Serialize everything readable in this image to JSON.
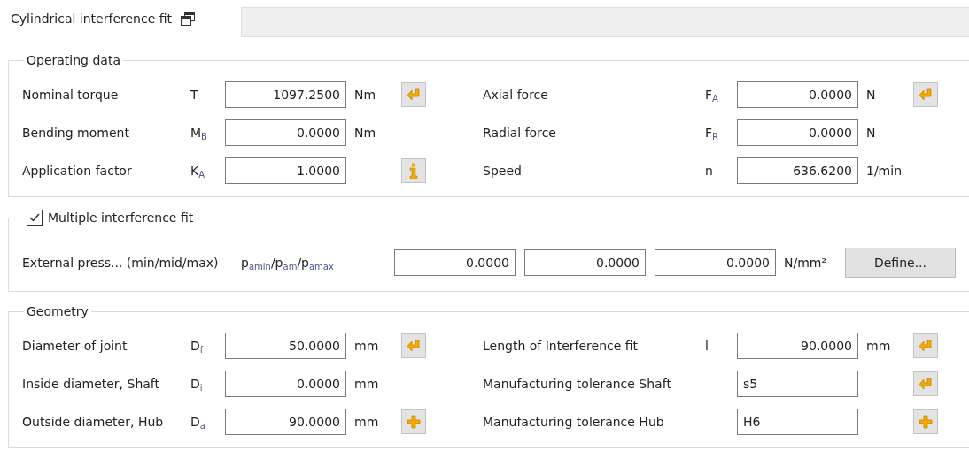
{
  "tab": {
    "title": "Cylindrical interference fit",
    "selected": true
  },
  "operating_data": {
    "title": "Operating data",
    "left": [
      {
        "kind": "numeric",
        "label": "Nominal torque",
        "symbol": "T",
        "value": "1097.2500",
        "unit": "Nm",
        "button": {
          "kind": "enter"
        }
      },
      {
        "kind": "numeric",
        "label": "Bending moment",
        "symbol": "M$_{B}$",
        "value": "0.0000",
        "unit": "Nm"
      },
      {
        "kind": "numeric",
        "label": "Application factor",
        "symbol": "K$_{A}$",
        "value": "1.0000",
        "button": {
          "kind": "info"
        }
      }
    ],
    "right": [
      {
        "kind": "numeric",
        "label": "Axial force",
        "symbol": "F$_{A}$",
        "value": "0.0000",
        "unit": "N",
        "button": {
          "kind": "enter"
        }
      },
      {
        "kind": "numeric",
        "label": "Radial force",
        "symbol": "F$_{R}$",
        "value": "0.0000",
        "unit": "N"
      },
      {
        "kind": "numeric",
        "label": "Speed",
        "symbol": "n",
        "value": "636.6200",
        "unit": "1/min"
      }
    ]
  },
  "multiple_fit": {
    "title": "Multiple interference fit",
    "checked": true,
    "label": "External press... (min/mid/max)",
    "symbol": "p$_{amin}$/p$_{am}$/p$_{amax}$",
    "values": [
      "0.0000",
      "0.0000",
      "0.0000"
    ],
    "unit": "N/mm²",
    "button": "Define..."
  },
  "geometry": {
    "title": "Geometry",
    "left": [
      {
        "kind": "numeric",
        "label": "Diameter of joint",
        "symbol": "D$_{f}$",
        "value": "50.0000",
        "unit": "mm",
        "button": {
          "kind": "enter"
        }
      },
      {
        "kind": "numeric",
        "label": "Inside diameter, Shaft",
        "symbol": "D$_{i}$",
        "value": "0.0000",
        "unit": "mm"
      },
      {
        "kind": "numeric",
        "label": "Outside diameter, Hub",
        "symbol": "D$_{a}$",
        "value": "90.0000",
        "unit": "mm",
        "button": {
          "kind": "plus"
        }
      }
    ],
    "right": [
      {
        "kind": "numeric",
        "label": "Length of Interference fit",
        "symbol": "l",
        "value": "90.0000",
        "unit": "mm",
        "button": {
          "kind": "enter"
        }
      },
      {
        "kind": "text",
        "label": "Manufacturing tolerance Shaft",
        "value": "s5",
        "button": {
          "kind": "enter"
        }
      },
      {
        "kind": "text",
        "label": "Manufacturing tolerance Hub",
        "value": "H6",
        "button": {
          "kind": "plus"
        }
      }
    ]
  }
}
